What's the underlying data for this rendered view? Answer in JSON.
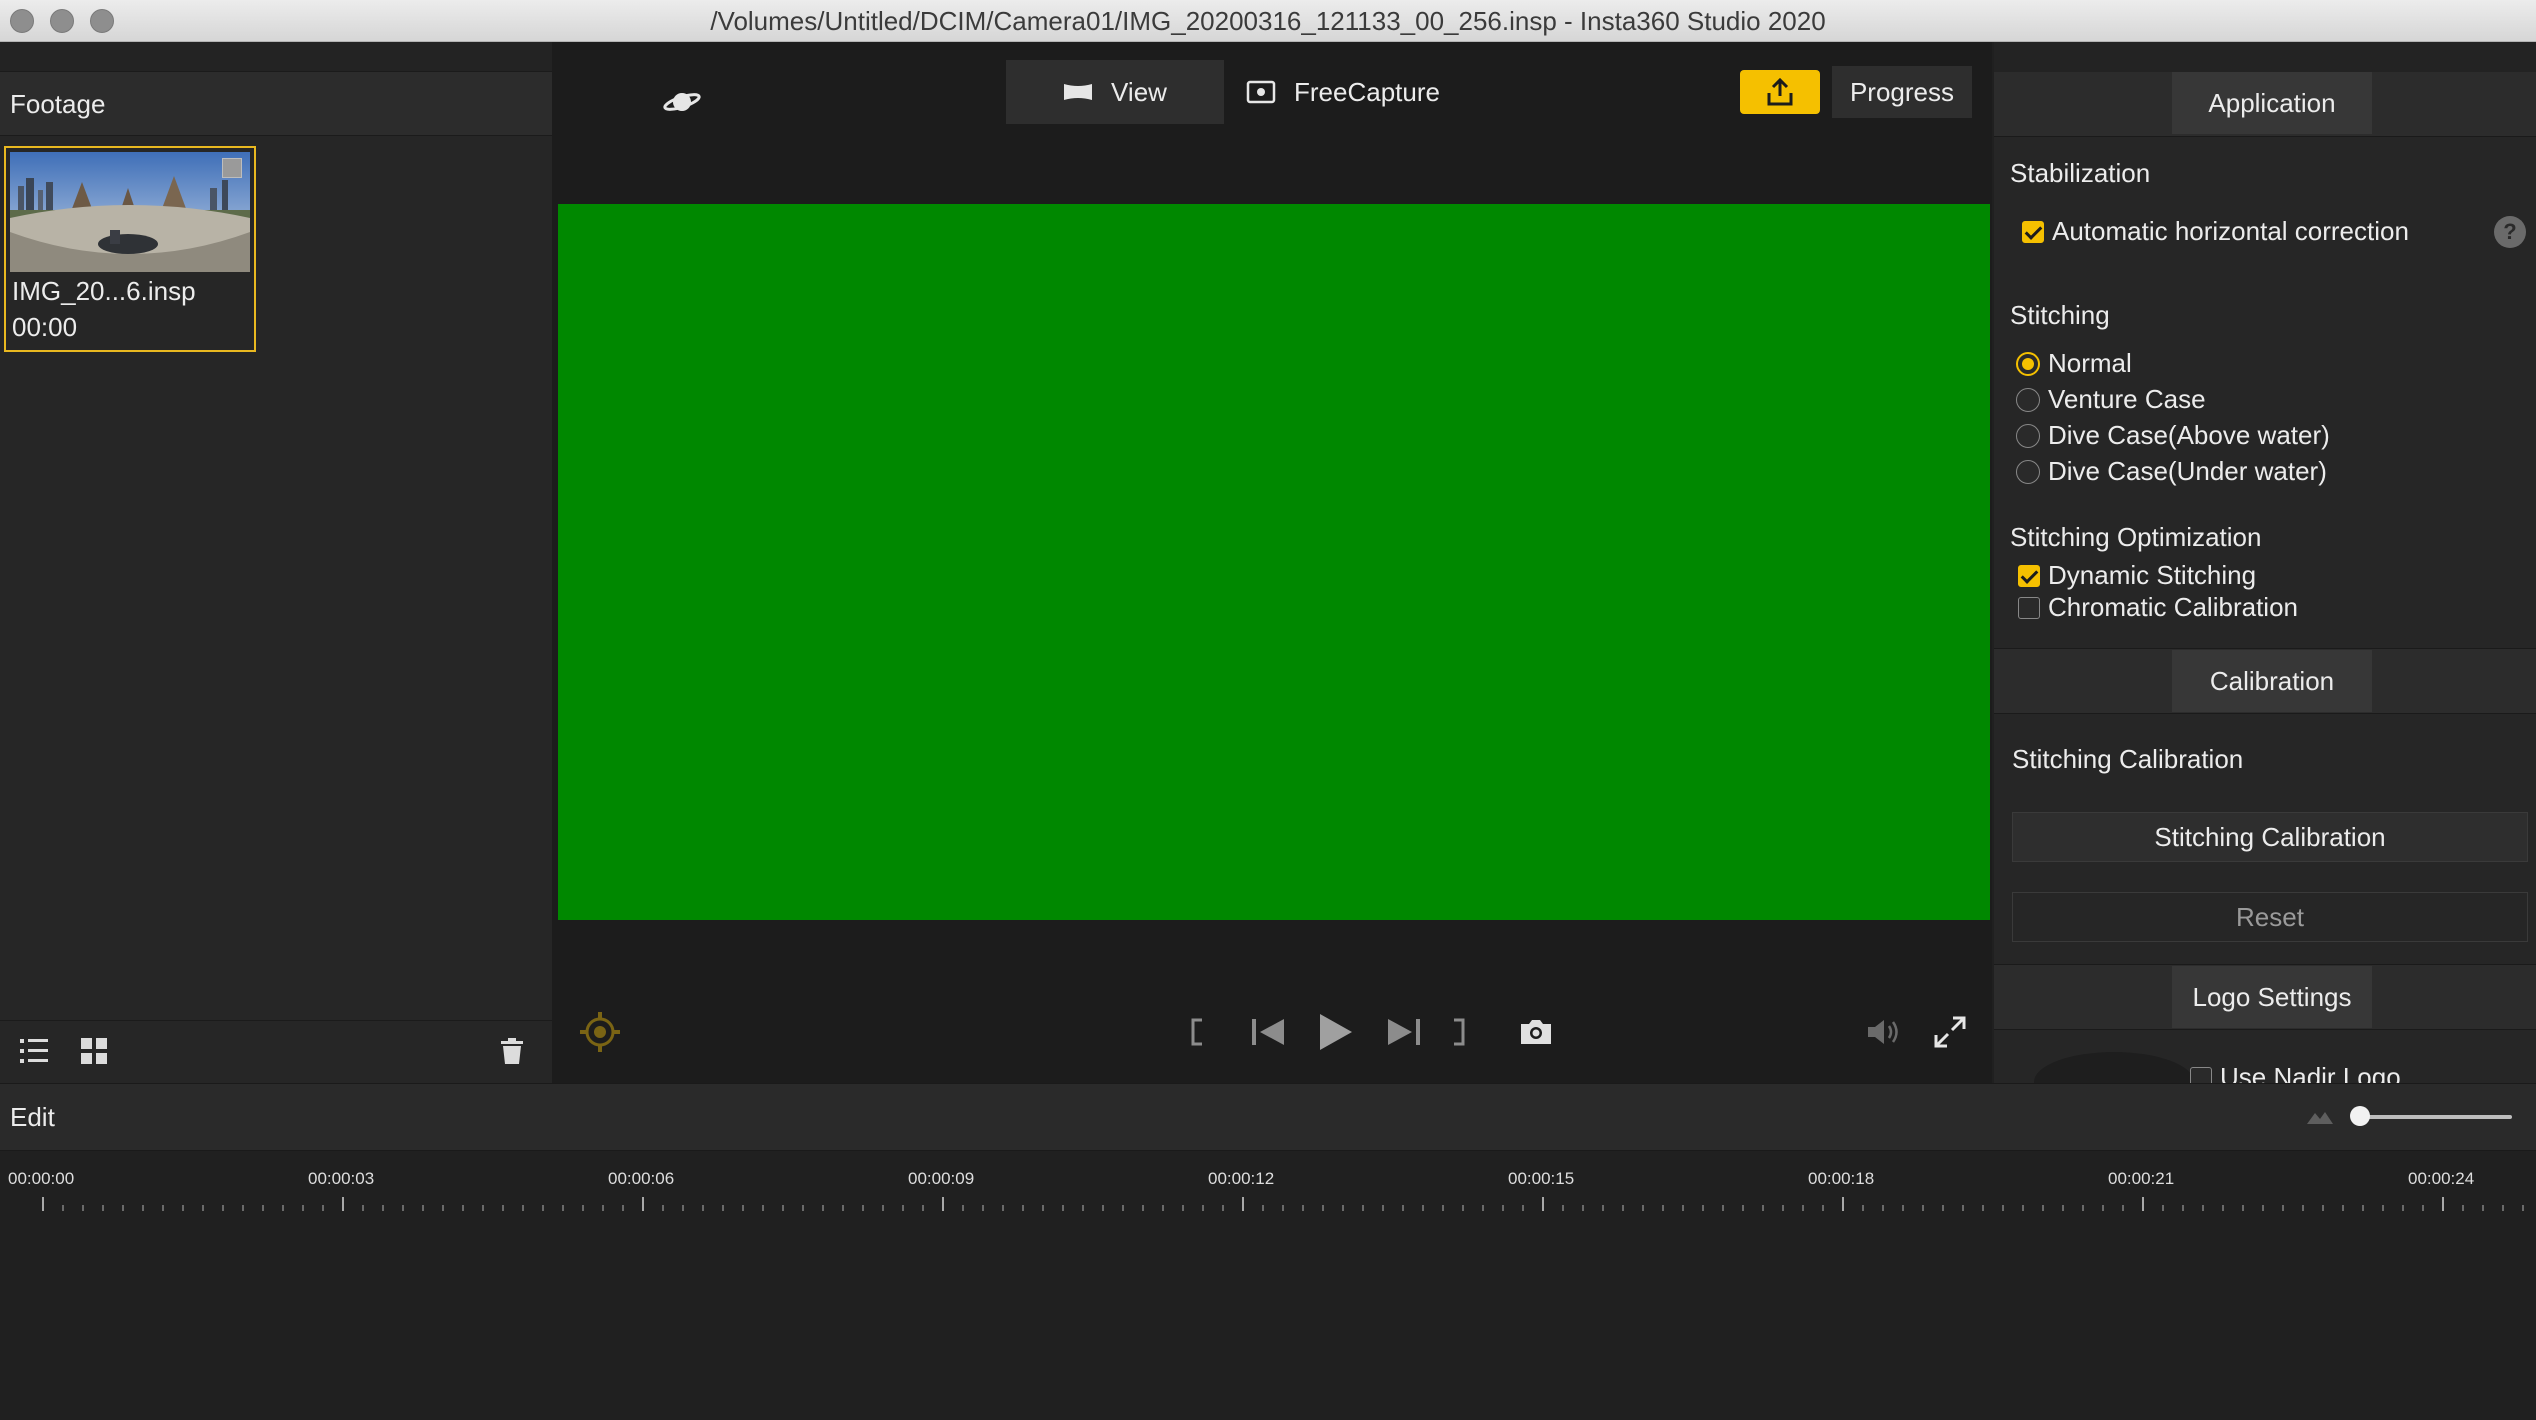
{
  "window": {
    "title": "/Volumes/Untitled/DCIM/Camera01/IMG_20200316_121133_00_256.insp - Insta360 Studio 2020"
  },
  "footage": {
    "title": "Footage",
    "items": [
      {
        "name": "IMG_20...6.insp",
        "duration": "00:00",
        "selected": true
      }
    ]
  },
  "viewer": {
    "view_label": "View",
    "freecapture_label": "FreeCapture",
    "progress_label": "Progress",
    "preview_color": "#008800"
  },
  "settings": {
    "application_tab": "Application",
    "stabilization_heading": "Stabilization",
    "auto_horizontal": {
      "label": "Automatic horizontal correction",
      "checked": true
    },
    "help_glyph": "?",
    "stitching_heading": "Stitching",
    "stitching_options": [
      {
        "label": "Normal",
        "selected": true
      },
      {
        "label": "Venture Case",
        "selected": false
      },
      {
        "label": "Dive Case(Above water)",
        "selected": false
      },
      {
        "label": "Dive Case(Under water)",
        "selected": false
      }
    ],
    "optimization_heading": "Stitching Optimization",
    "optimization_options": [
      {
        "label": "Dynamic Stitching",
        "checked": true
      },
      {
        "label": "Chromatic Calibration",
        "checked": false
      }
    ],
    "calibration_tab": "Calibration",
    "stitching_calibration_heading": "Stitching Calibration",
    "stitching_calibration_button": "Stitching Calibration",
    "reset_button": "Reset",
    "logo_tab": "Logo Settings",
    "use_nadir_logo": {
      "label": "Use Nadir Logo",
      "checked": false
    }
  },
  "edit": {
    "title": "Edit",
    "zoom_level": 0.05,
    "ticks": [
      "00:00:00",
      "00:00:03",
      "00:00:06",
      "00:00:09",
      "00:00:12",
      "00:00:15",
      "00:00:18",
      "00:00:21",
      "00:00:24"
    ]
  },
  "colors": {
    "accent": "#f5c000",
    "selection_border": "#e9b820"
  }
}
